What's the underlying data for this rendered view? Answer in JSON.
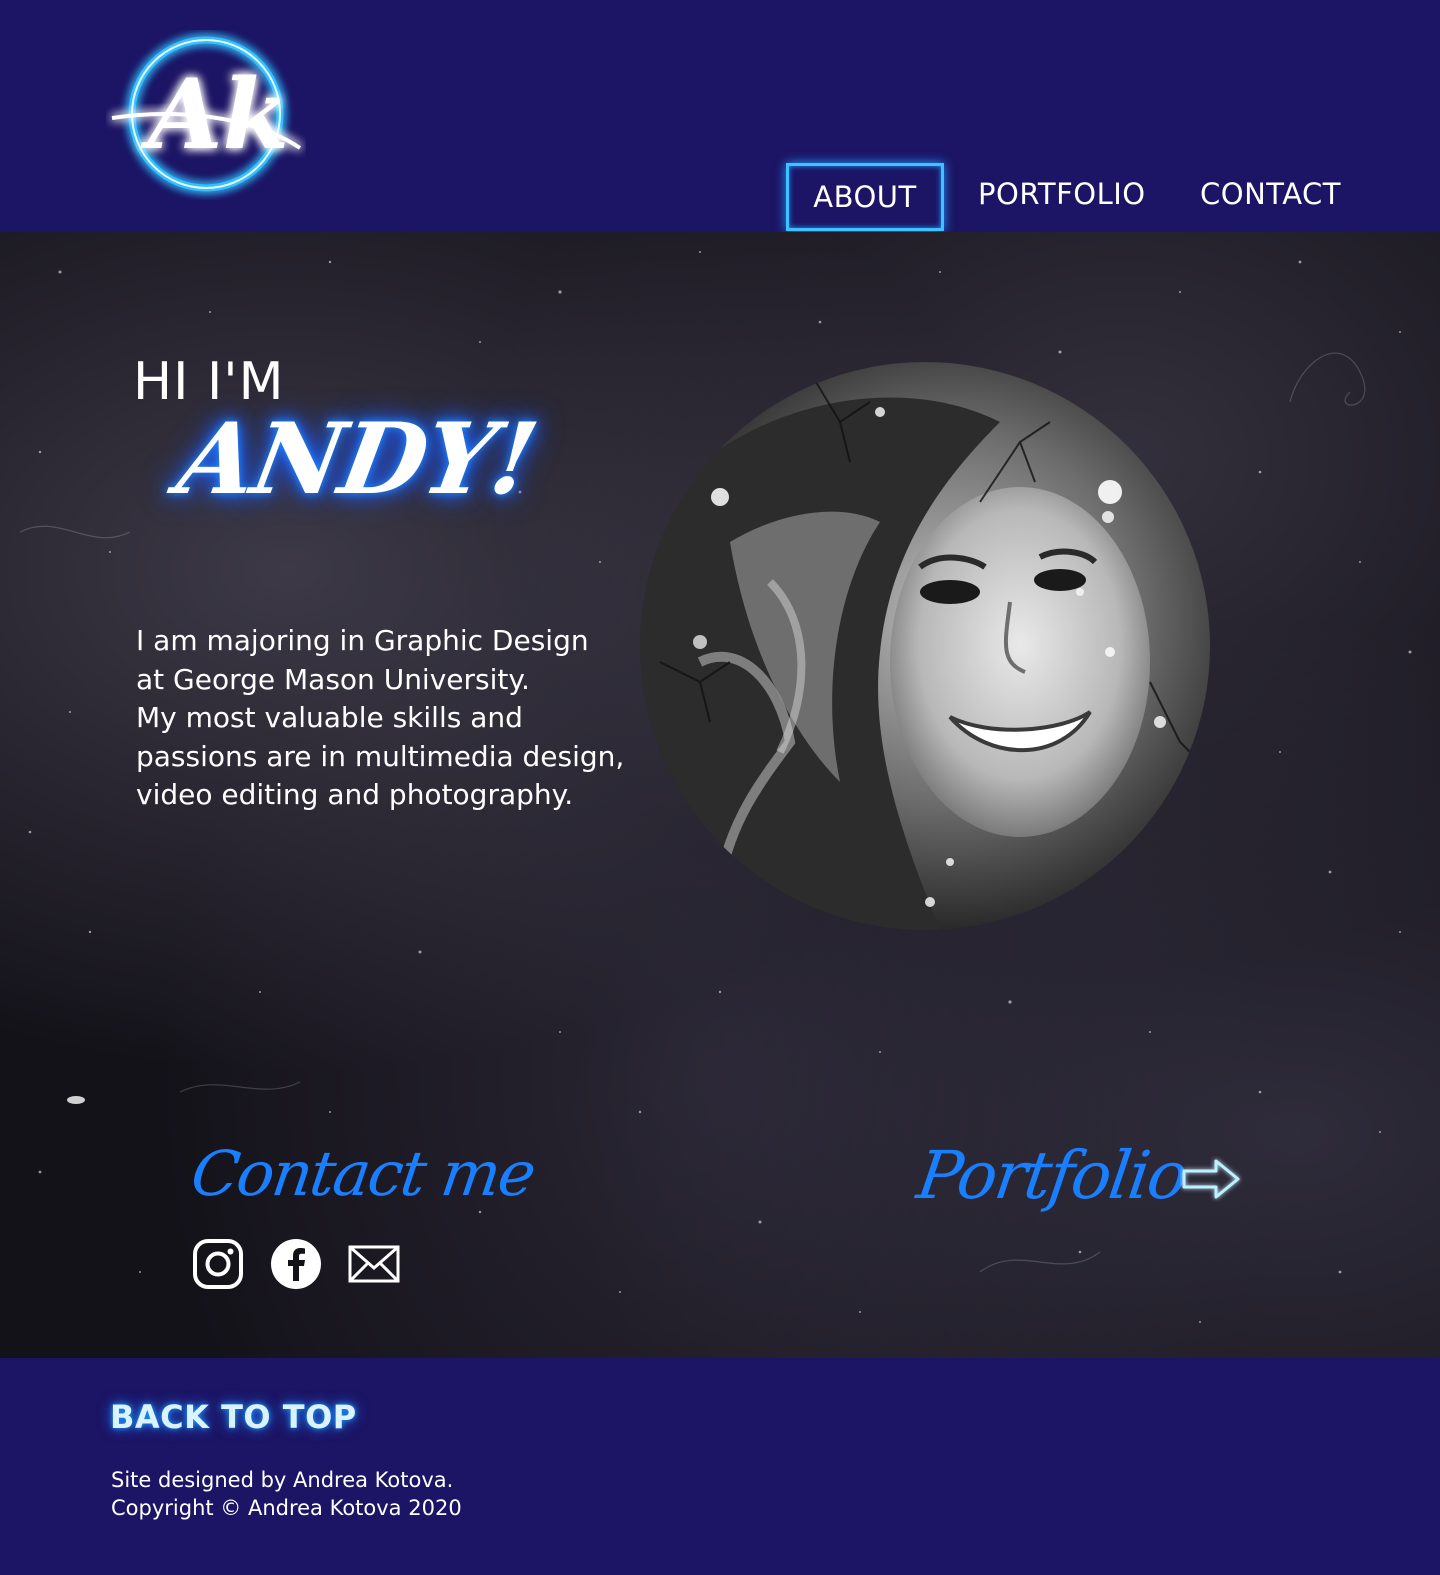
{
  "header": {
    "logo_text": "Ak",
    "nav": {
      "about": "ABOUT",
      "portfolio": "PORTFOLIO",
      "contact": "CONTACT"
    }
  },
  "hero": {
    "greeting": "HI I'M",
    "name": "ANDY!",
    "bio_lines": [
      "I am majoring in Graphic Design",
      "at George Mason University.",
      "My most valuable skills and",
      "passions are in multimedia design,",
      "video editing and photography."
    ]
  },
  "contact": {
    "title": "Contact me",
    "icons": [
      "instagram-icon",
      "facebook-icon",
      "mail-icon"
    ]
  },
  "portfolio_link": {
    "label": "Portfolio",
    "icon": "arrow-right-icon"
  },
  "footer": {
    "back_to_top": "BACK TO TOP",
    "credit_lines": [
      "Site designed by Andrea Kotova.",
      "Copyright © Andrea Kotova 2020"
    ]
  },
  "colors": {
    "header_bg": "#1c1464",
    "accent_blue": "#1a7fff",
    "glow_cyan": "#3ec3ff",
    "main_bg": "#141219"
  }
}
